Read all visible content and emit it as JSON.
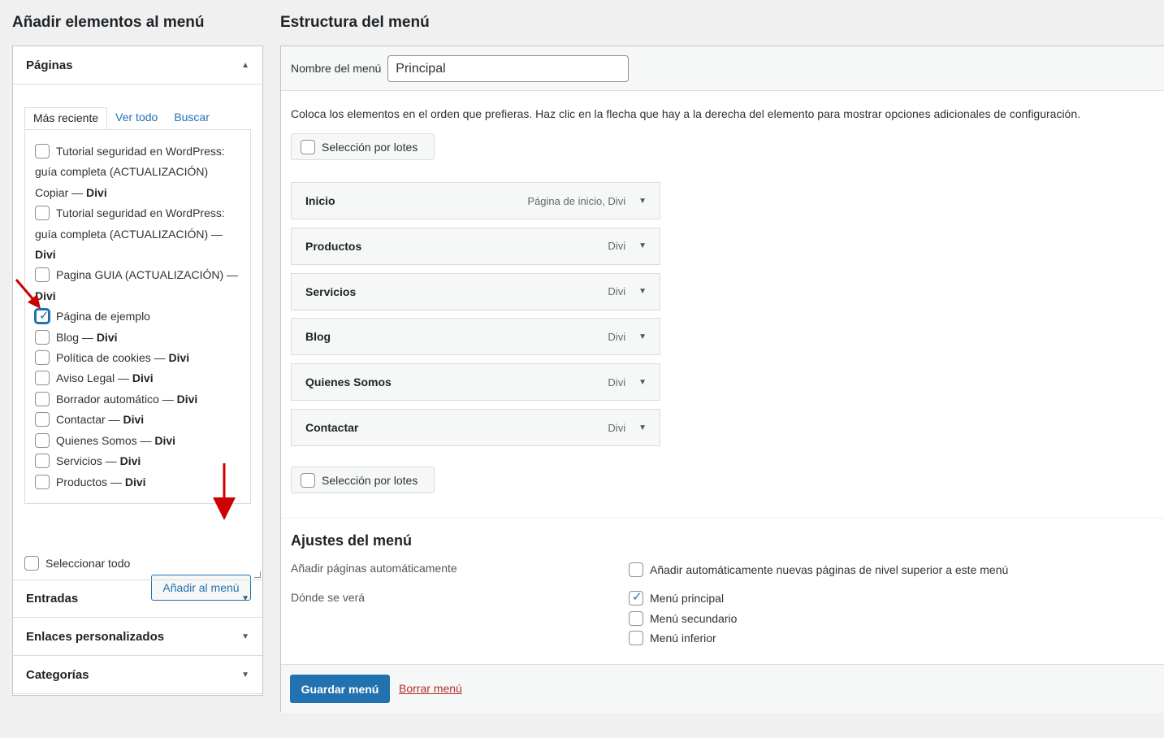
{
  "left": {
    "title": "Añadir elementos al menú",
    "pages_panel": {
      "title": "Páginas",
      "tabs": [
        "Más reciente",
        "Ver todo",
        "Buscar"
      ],
      "items": [
        {
          "label": "Tutorial seguridad en WordPress: guía completa (ACTUALIZACIÓN) Copiar",
          "suffix": "Divi",
          "checked": false
        },
        {
          "label": "Tutorial seguridad en WordPress: guía completa (ACTUALIZACIÓN)",
          "suffix": "Divi",
          "checked": false
        },
        {
          "label": "Pagina GUIA (ACTUALIZACIÓN)",
          "suffix": "Divi",
          "checked": false
        },
        {
          "label": "Página de ejemplo",
          "suffix": "",
          "checked": true
        },
        {
          "label": "Blog",
          "suffix": "Divi",
          "checked": false
        },
        {
          "label": "Política de cookies",
          "suffix": "Divi",
          "checked": false
        },
        {
          "label": "Aviso Legal",
          "suffix": "Divi",
          "checked": false
        },
        {
          "label": "Borrador automático",
          "suffix": "Divi",
          "checked": false
        },
        {
          "label": "Contactar",
          "suffix": "Divi",
          "checked": false
        },
        {
          "label": "Quienes Somos",
          "suffix": "Divi",
          "checked": false
        },
        {
          "label": "Servicios",
          "suffix": "Divi",
          "checked": false
        },
        {
          "label": "Productos",
          "suffix": "Divi",
          "checked": false
        }
      ],
      "select_all": "Seleccionar todo",
      "add_button": "Añadir al menú"
    },
    "other_panels": [
      "Entradas",
      "Enlaces personalizados",
      "Categorías"
    ]
  },
  "right": {
    "title": "Estructura del menú",
    "name_label": "Nombre del menú",
    "name_value": "Principal",
    "instructions": "Coloca los elementos en el orden que prefieras. Haz clic en la flecha que hay a la derecha del elemento para mostrar opciones adicionales de configuración.",
    "bulk_select": "Selección por lotes",
    "menu_items": [
      {
        "title": "Inicio",
        "meta": "Página de inicio, Divi"
      },
      {
        "title": "Productos",
        "meta": "Divi"
      },
      {
        "title": "Servicios",
        "meta": "Divi"
      },
      {
        "title": "Blog",
        "meta": "Divi"
      },
      {
        "title": "Quienes Somos",
        "meta": "Divi"
      },
      {
        "title": "Contactar",
        "meta": "Divi"
      }
    ],
    "settings": {
      "title": "Ajustes del menú",
      "auto_add_label": "Añadir páginas automáticamente",
      "auto_add_option": "Añadir automáticamente nuevas páginas de nivel superior a este menú",
      "location_label": "Dónde se verá",
      "locations": [
        {
          "label": "Menú principal",
          "checked": true
        },
        {
          "label": "Menú secundario",
          "checked": false
        },
        {
          "label": "Menú inferior",
          "checked": false
        }
      ]
    },
    "save_button": "Guardar menú",
    "delete_link": "Borrar menú"
  },
  "colors": {
    "accent": "#2271b1",
    "danger": "#b32d2e",
    "annotation_arrow": "#cc0000"
  }
}
